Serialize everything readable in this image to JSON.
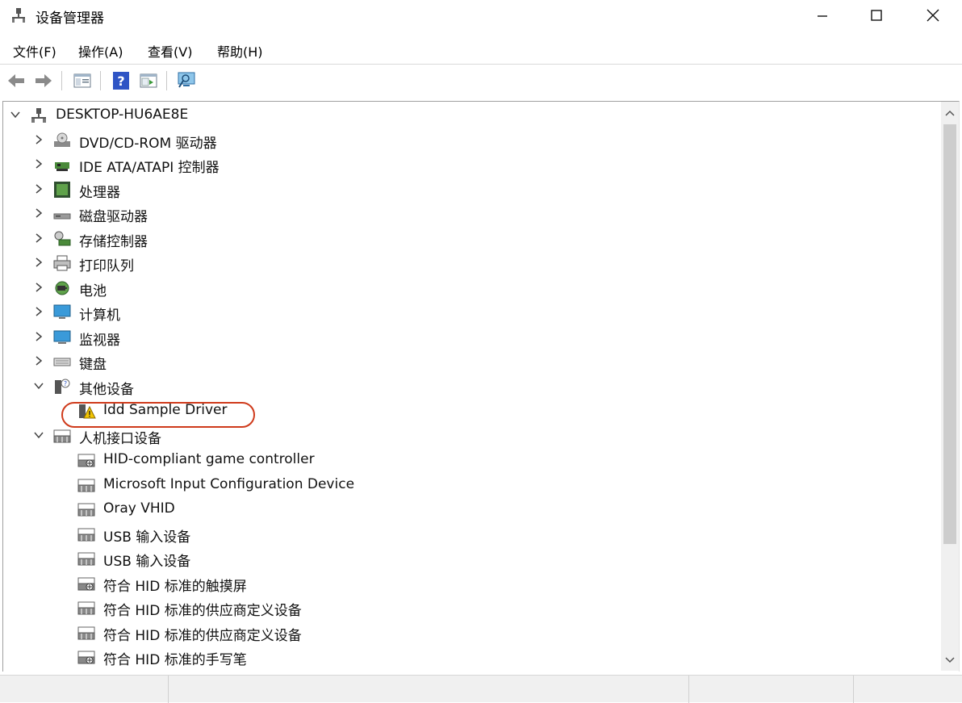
{
  "window": {
    "title": "设备管理器"
  },
  "menu": [
    "文件(F)",
    "操作(A)",
    "查看(V)",
    "帮助(H)"
  ],
  "toolbar": [
    "back-arrow-icon",
    "forward-arrow-icon",
    "properties-pane-icon",
    "help-icon",
    "show-pane-icon",
    "scan-hardware-icon"
  ],
  "tree": {
    "root": "DESKTOP-HU6AE8E",
    "items": [
      {
        "label": "DVD/CD-ROM 驱动器",
        "icon": "dvd-drive-icon",
        "expanded": false
      },
      {
        "label": "IDE ATA/ATAPI 控制器",
        "icon": "ide-controller-icon",
        "expanded": false
      },
      {
        "label": "处理器",
        "icon": "processor-icon",
        "expanded": false
      },
      {
        "label": "磁盘驱动器",
        "icon": "disk-drive-icon",
        "expanded": false
      },
      {
        "label": "存储控制器",
        "icon": "storage-controller-icon",
        "expanded": false
      },
      {
        "label": "打印队列",
        "icon": "printer-icon",
        "expanded": false
      },
      {
        "label": "电池",
        "icon": "battery-icon",
        "expanded": false
      },
      {
        "label": "计算机",
        "icon": "computer-icon",
        "expanded": false
      },
      {
        "label": "监视器",
        "icon": "monitor-icon",
        "expanded": false
      },
      {
        "label": "键盘",
        "icon": "keyboard-icon",
        "expanded": false
      },
      {
        "label": "其他设备",
        "icon": "other-devices-icon",
        "expanded": true
      },
      {
        "label": "Idd Sample Driver",
        "icon": "warning-device-icon",
        "child": true
      },
      {
        "label": "人机接口设备",
        "icon": "hid-icon",
        "expanded": true
      },
      {
        "label": "HID-compliant game controller",
        "icon": "hid-device-icon",
        "child": true
      },
      {
        "label": "Microsoft Input Configuration Device",
        "icon": "hid-device-icon",
        "child": true
      },
      {
        "label": "Oray VHID",
        "icon": "hid-device-icon",
        "child": true
      },
      {
        "label": "USB 输入设备",
        "icon": "hid-device-icon",
        "child": true
      },
      {
        "label": "USB 输入设备",
        "icon": "hid-device-icon",
        "child": true
      },
      {
        "label": "符合 HID 标准的触摸屏",
        "icon": "hid-device-icon",
        "child": true
      },
      {
        "label": "符合 HID 标准的供应商定义设备",
        "icon": "hid-device-icon",
        "child": true
      },
      {
        "label": "符合 HID 标准的供应商定义设备",
        "icon": "hid-device-icon",
        "child": true
      },
      {
        "label": "符合 HID 标准的手写笔",
        "icon": "hid-device-icon",
        "child": true
      }
    ]
  },
  "colors": {
    "highlight_circle": "#cf3a1b",
    "selection": "#ffffff"
  }
}
